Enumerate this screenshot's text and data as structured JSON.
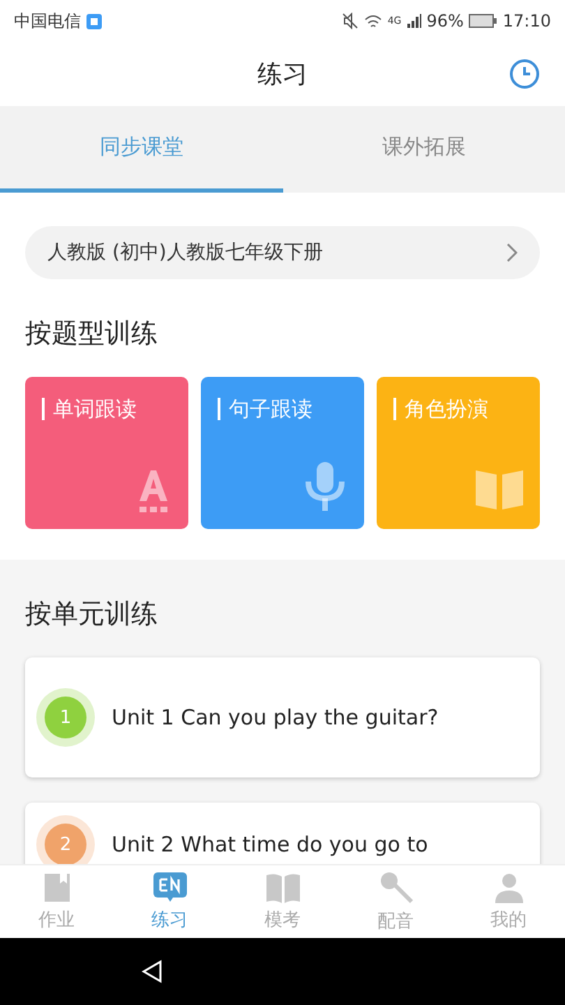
{
  "status_bar": {
    "carrier": "中国电信",
    "network": "4G",
    "battery": "96%",
    "time": "17:10"
  },
  "header": {
    "title": "练习"
  },
  "tabs": [
    {
      "label": "同步课堂",
      "selected": true
    },
    {
      "label": "课外拓展",
      "selected": false
    }
  ],
  "textbook": {
    "label": "人教版 (初中)人教版七年级下册"
  },
  "by_type": {
    "title": "按题型训练",
    "cards": [
      {
        "label": "单词跟读",
        "kind": "word",
        "color": "#f45d7b"
      },
      {
        "label": "句子跟读",
        "kind": "sentence",
        "color": "#3d9cf5"
      },
      {
        "label": "角色扮演",
        "kind": "role",
        "color": "#fcb314"
      }
    ]
  },
  "by_unit": {
    "title": "按单元训练",
    "units": [
      {
        "number": "1",
        "title": "Unit 1 Can you play the guitar?",
        "color": "#8fd13f"
      },
      {
        "number": "2",
        "title": "Unit 2 What time do you go to",
        "color": "#f0a36a"
      }
    ]
  },
  "bottom_nav": [
    {
      "label": "作业",
      "kind": "homework",
      "selected": false
    },
    {
      "label": "练习",
      "kind": "practice",
      "selected": true
    },
    {
      "label": "模考",
      "kind": "exam",
      "selected": false
    },
    {
      "label": "配音",
      "kind": "dub",
      "selected": false
    },
    {
      "label": "我的",
      "kind": "me",
      "selected": false
    }
  ]
}
